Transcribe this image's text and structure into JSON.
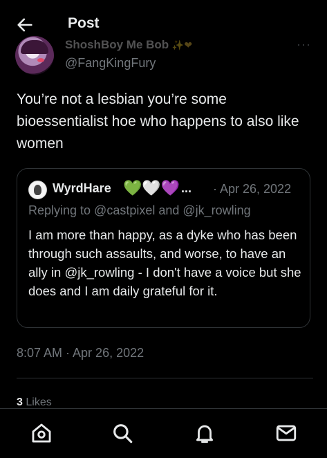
{
  "header": {
    "title": "Post"
  },
  "author": {
    "display_name": "ShoshBoy Me Bob",
    "name_emoji": "✨❤",
    "handle": "@FangKingFury",
    "more": "···"
  },
  "tweet": {
    "text": "You’re not a lesbian you’re some bioessentialist hoe who happens to also like women"
  },
  "quote": {
    "name": "WyrdHare",
    "name_emoji": "💚🤍💜",
    "ellipsis": "...",
    "date": "· Apr 26, 2022",
    "reply": "Replying to @castpixel and @jk_rowling",
    "text": "I am more than happy, as a dyke who has been through such assaults, and worse, to have an ally in @jk_rowling - I don't have a voice but she does and I am daily grateful for it."
  },
  "timestamp": "8:07 AM · Apr 26, 2022",
  "likes": {
    "count": "3",
    "label": "Likes"
  },
  "nav": {
    "items": [
      {
        "icon": "home-icon"
      },
      {
        "icon": "search-icon"
      },
      {
        "icon": "bell-icon"
      },
      {
        "icon": "mail-icon"
      }
    ]
  },
  "colors": {
    "background": "#000000",
    "text": "#e7e9ea",
    "muted": "#71767b",
    "border": "#2f3336"
  }
}
